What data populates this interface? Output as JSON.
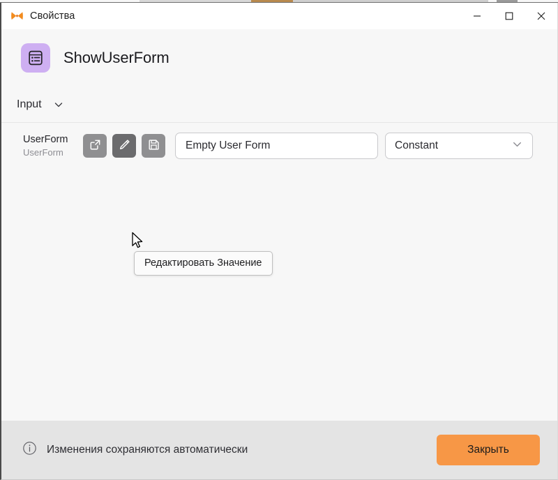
{
  "window": {
    "title": "Свойства",
    "logo_icon": "uipath-butterfly-logo",
    "controls": {
      "minimize": "minimize-icon",
      "maximize": "maximize-icon",
      "close": "close-icon"
    }
  },
  "header": {
    "activity_icon": "form-activity-icon",
    "activity_name": "ShowUserForm",
    "icon_bg_color": "#ceaff2"
  },
  "section": {
    "title": "Input",
    "chevron_icon": "chevron-down-icon",
    "expanded": true
  },
  "property": {
    "label": "UserForm",
    "type": "UserForm",
    "buttons": [
      {
        "name": "open-in-new-button",
        "icon": "open-in-new-icon",
        "hovered": false
      },
      {
        "name": "edit-value-button",
        "icon": "pencil-icon",
        "hovered": true
      },
      {
        "name": "save-value-button",
        "icon": "floppy-disk-icon",
        "hovered": false
      }
    ],
    "value": "Empty User Form",
    "value_placeholder": "Empty User Form",
    "kind": "Constant",
    "kind_chevron_icon": "chevron-down-icon"
  },
  "tooltip": {
    "text": "Редактировать Значение"
  },
  "footer": {
    "info_icon": "info-circle-icon",
    "note": "Изменения сохраняются автоматически",
    "close_label": "Закрыть",
    "close_color": "#f79746"
  },
  "cursor": {
    "icon": "arrow-cursor"
  }
}
